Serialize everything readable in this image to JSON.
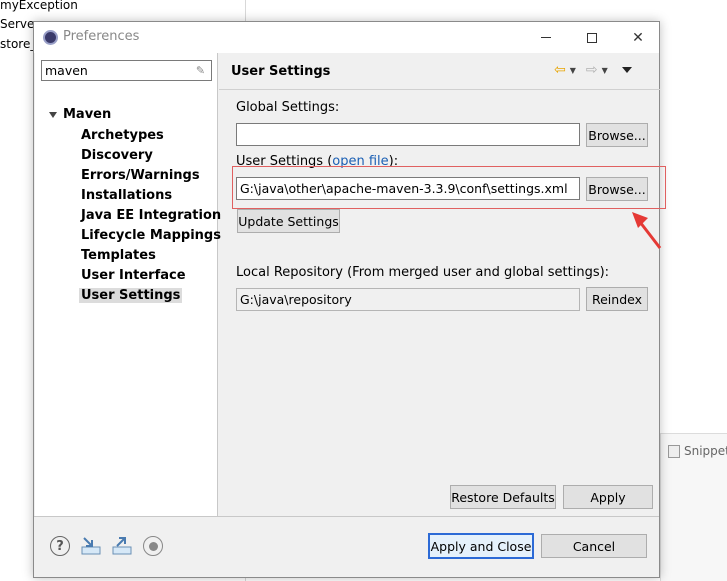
{
  "background": {
    "tree_items": [
      "myException",
      "Server",
      "store_"
    ],
    "snippets_tab": "Snippet"
  },
  "dialog": {
    "title": "Preferences",
    "filter": {
      "value": "maven"
    },
    "nav": {
      "root": "Maven",
      "children": [
        "Archetypes",
        "Discovery",
        "Errors/Warnings",
        "Installations",
        "Java EE Integration",
        "Lifecycle Mappings",
        "Templates",
        "User Interface",
        "User Settings"
      ],
      "selected": "User Settings"
    },
    "content": {
      "title": "User Settings",
      "global_settings_label": "Global Settings:",
      "global_settings_value": "",
      "user_settings_label": "User Settings (",
      "user_settings_link": "open file",
      "user_settings_label_end": "):",
      "user_settings_value": "G:\\java\\other\\apache-maven-3.3.9\\conf\\settings.xml",
      "browse_label": "Browse...",
      "update_settings_label": "Update Settings",
      "local_repo_label": "Local Repository (From merged user and global settings):",
      "local_repo_value": "G:\\java\\repository",
      "reindex_label": "Reindex",
      "restore_defaults_label": "Restore Defaults",
      "apply_label": "Apply"
    },
    "footer": {
      "apply_close_label": "Apply and Close",
      "cancel_label": "Cancel"
    }
  },
  "colors": {
    "highlight": "#e06060",
    "arrow_annotation": "#e53935",
    "link": "#1a5fb4",
    "default_button_border": "#2c6ad6"
  },
  "icons": [
    "preferences-icon",
    "minimize-icon",
    "maximize-icon",
    "close-icon",
    "clear-filter-icon",
    "back-arrow-icon",
    "forward-arrow-icon",
    "view-menu-icon",
    "help-icon",
    "import-icon",
    "export-icon",
    "record-icon",
    "annotation-arrow-icon"
  ]
}
